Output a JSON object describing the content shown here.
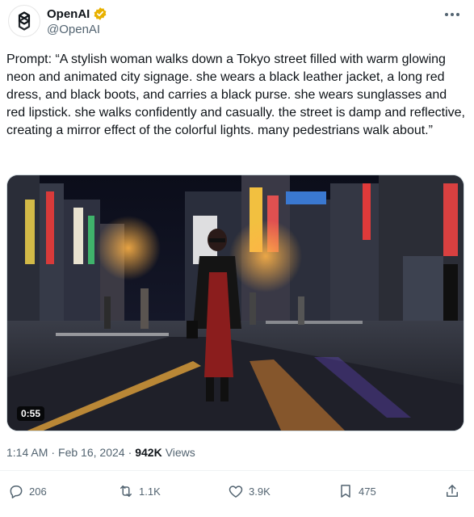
{
  "author": {
    "display_name": "OpenAI",
    "handle": "@OpenAI",
    "avatar_icon": "openai-logo-icon",
    "verified_icon": "verified-badge-icon",
    "verified_color": "#e8b100"
  },
  "tweet": {
    "text": "Prompt: “A stylish woman walks down a Tokyo street filled with warm glowing neon and animated city signage. she wears a black leather jacket, a long red dress, and black boots, and carries a black purse. she wears sunglasses and red lipstick. she walks confidently and casually. the street is damp and reflective, creating a mirror effect of the colorful lights. many pedestrians walk about.”"
  },
  "media": {
    "type": "video",
    "duration": "0:55"
  },
  "meta": {
    "time": "1:14 AM",
    "separator": "·",
    "date": "Feb 16, 2024",
    "separator2": "·",
    "views_count": "942K",
    "views_label": "Views"
  },
  "actions": {
    "replies": "206",
    "reposts": "1.1K",
    "likes": "3.9K",
    "bookmarks": "475"
  },
  "colors": {
    "text_primary": "#0f1419",
    "text_secondary": "#536471"
  }
}
